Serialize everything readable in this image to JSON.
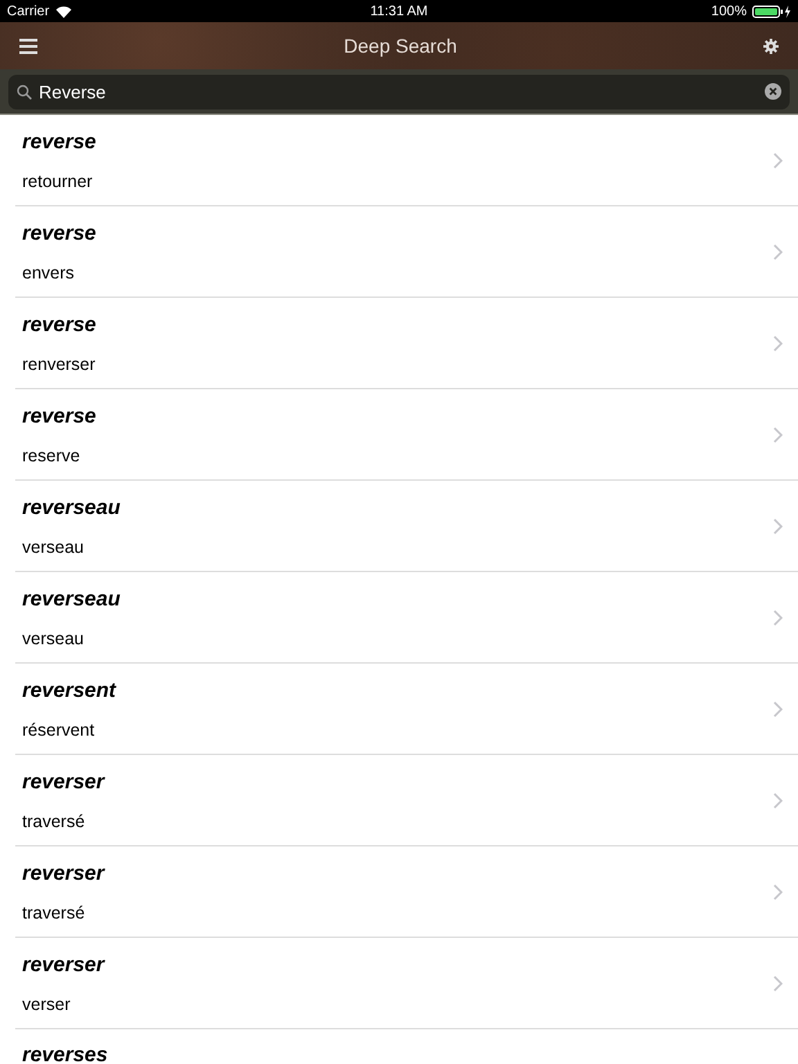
{
  "status_bar": {
    "carrier": "Carrier",
    "time": "11:31 AM",
    "battery": "100%"
  },
  "nav_bar": {
    "title": "Deep Search"
  },
  "search": {
    "value": "Reverse"
  },
  "results": [
    {
      "term": "reverse",
      "translation": "retourner"
    },
    {
      "term": "reverse",
      "translation": "envers"
    },
    {
      "term": "reverse",
      "translation": "renverser"
    },
    {
      "term": "reverse",
      "translation": "reserve"
    },
    {
      "term": "reverseau",
      "translation": "verseau"
    },
    {
      "term": "reverseau",
      "translation": "verseau"
    },
    {
      "term": "reversent",
      "translation": "réservent"
    },
    {
      "term": "reverser",
      "translation": "traversé"
    },
    {
      "term": "reverser",
      "translation": "traversé"
    },
    {
      "term": "reverser",
      "translation": "verser"
    },
    {
      "term": "reverses"
    }
  ]
}
